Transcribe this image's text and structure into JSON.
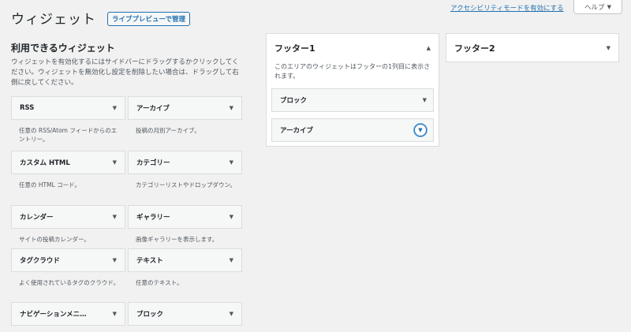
{
  "page": {
    "title": "ウィジェット",
    "live_preview_label": "ライブプレビューで管理"
  },
  "top_right": {
    "accessibility_link": "アクセシビリティモードを有効にする",
    "help_label": "ヘルプ"
  },
  "available": {
    "heading": "利用できるウィジェット",
    "description": "ウィジェットを有効化するにはサイドバーにドラッグするかクリックしてください。ウィジェットを無効化し設定を削除したい場合は、ドラッグして右側に戻してください。",
    "widgets": [
      {
        "title": "RSS",
        "desc": "任意の RSS/Atom フィードからのエントリー。"
      },
      {
        "title": "アーカイブ",
        "desc": "投稿の月別アーカイブ。"
      },
      {
        "title": "カスタム HTML",
        "desc": "任意の HTML コード。"
      },
      {
        "title": "カテゴリー",
        "desc": "カテゴリーリストやドロップダウン。"
      },
      {
        "title": "カレンダー",
        "desc": "サイトの投稿カレンダー。"
      },
      {
        "title": "ギャラリー",
        "desc": "画像ギャラリーを表示します。"
      },
      {
        "title": "タグクラウド",
        "desc": "よく使用されているタグのクラウド。"
      },
      {
        "title": "テキスト",
        "desc": "任意のテキスト。"
      },
      {
        "title": "ナビゲーションメニ…",
        "desc": ""
      },
      {
        "title": "ブロック",
        "desc": ""
      }
    ]
  },
  "footer1": {
    "title": "フッター1",
    "description": "このエリアのウィジェットはフッターの1列目に表示されます。",
    "widgets": [
      {
        "title": "ブロック"
      },
      {
        "title": "アーカイブ"
      }
    ]
  },
  "footer2": {
    "title": "フッター2"
  },
  "icons": {
    "down": "▼",
    "up": "▲"
  }
}
